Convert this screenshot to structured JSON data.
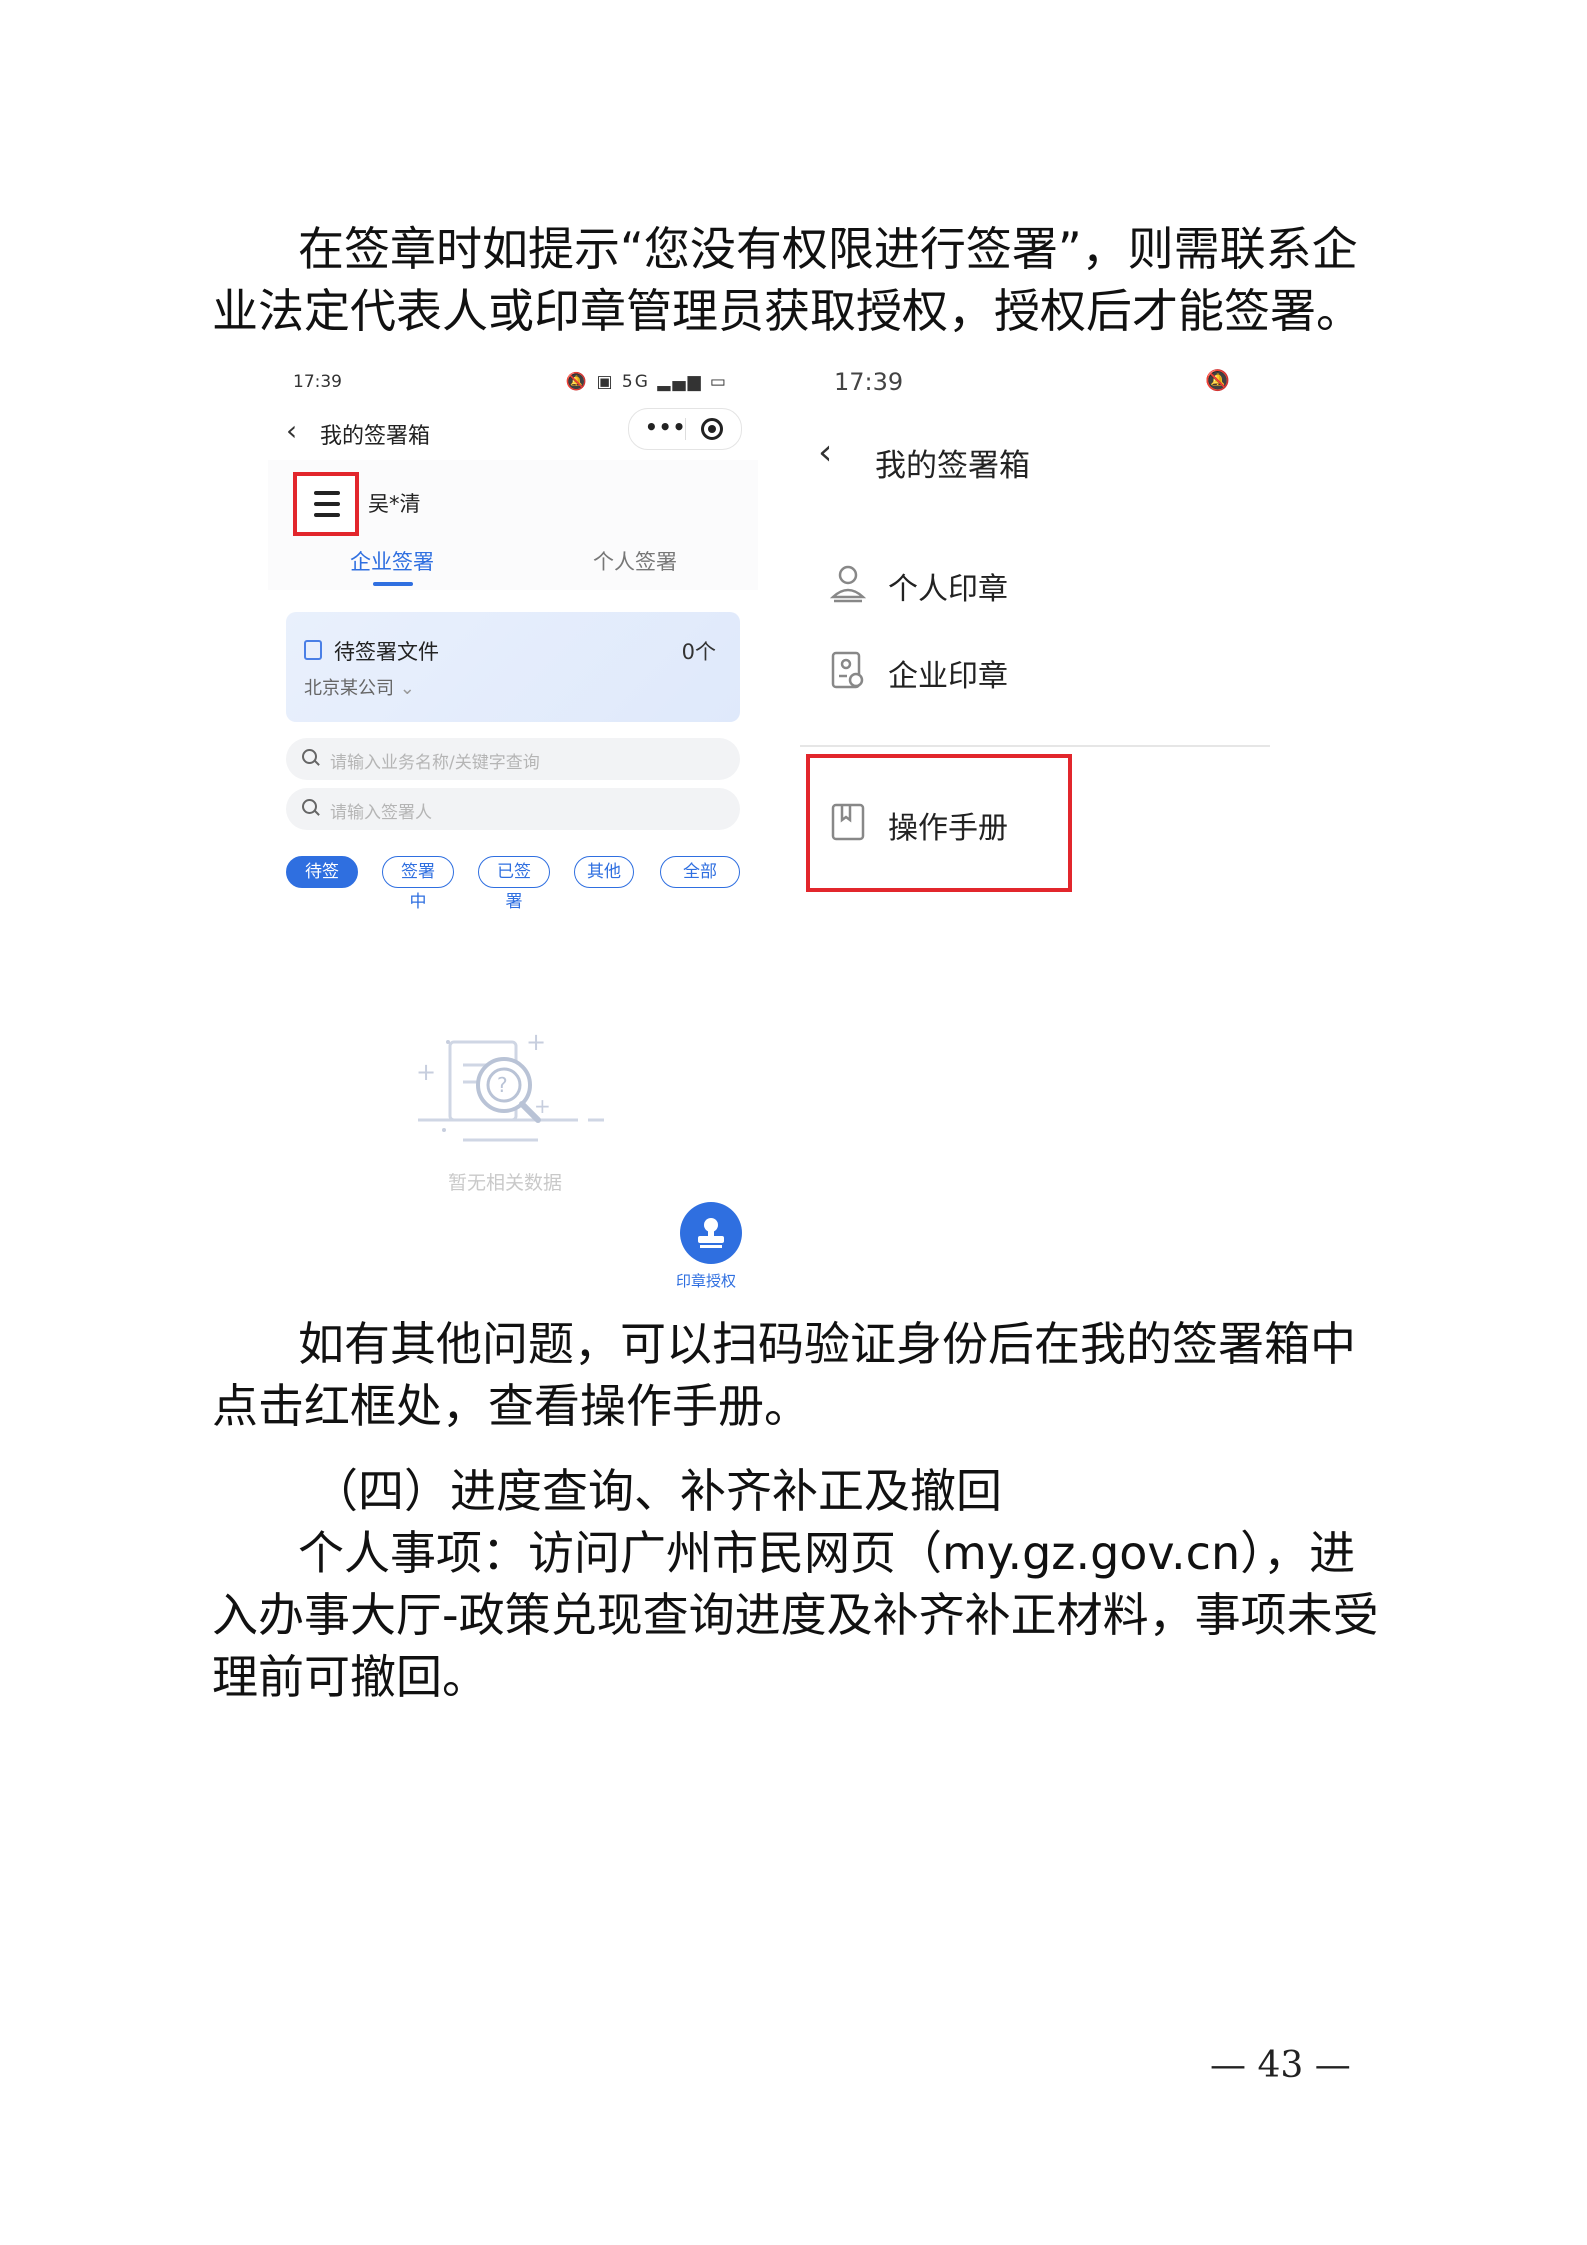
{
  "paragraphs": {
    "p1": "在签章时如提示“您没有权限进行签署”，则需联系企业法定代表人或印章管理员获取授权，授权后才能签署。",
    "p2": "如有其他问题，可以扫码验证身份后在我的签署箱中点击红框处，查看操作手册。",
    "section_heading": "（四）进度查询、补齐补正及撤回",
    "p3": "个人事项：访问广州市民网页（my.gz.gov.cn），进入办事大厅-政策兑现查询进度及补齐补正材料，事项未受理前可撤回。"
  },
  "left_screen": {
    "status_time": "17:39",
    "status_icons": "🔕 ▣ 5G ▂▄▆ ▭",
    "title": "我的签署箱",
    "user_name": "吴*清",
    "tabs": [
      "企业签署",
      "个人签署"
    ],
    "pending": {
      "title": "待签署文件",
      "count": "0个",
      "company": "北京某公司"
    },
    "search_placeholders": [
      "请输入业务名称/关键字查询",
      "请输入签署人"
    ],
    "filters": [
      "待签署",
      "签署中",
      "已签署",
      "其他",
      "全部"
    ],
    "empty_text": "暂无相关数据",
    "seal_auth_label": "印章授权"
  },
  "right_screen": {
    "status_time": "17:39",
    "status_icons": "🔕",
    "title": "我的签署箱",
    "menu": [
      "个人印章",
      "企业印章",
      "操作手册"
    ]
  },
  "page_number": "— 43 —",
  "colors": {
    "accent": "#2f6fe0",
    "highlight_red": "#e2262c"
  }
}
